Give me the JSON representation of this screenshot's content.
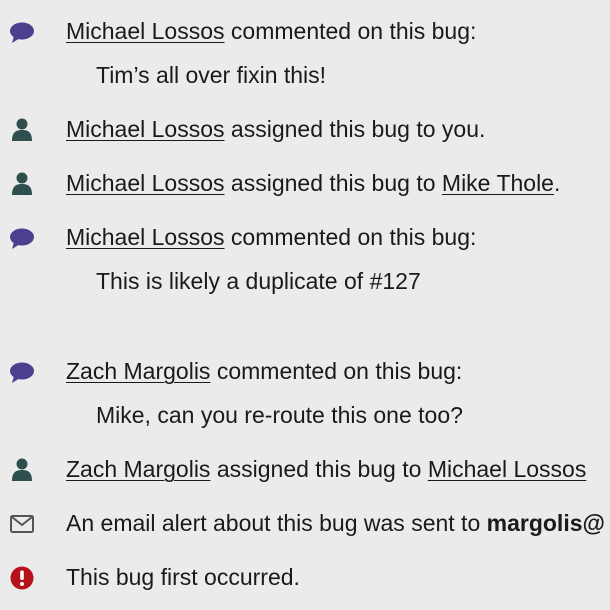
{
  "colors": {
    "comment_icon": "#4b3f8f",
    "person_icon": "#2f4f4f",
    "mail_icon": "#555555",
    "alert_icon": "#b5121b",
    "background": "#ebebeb"
  },
  "activity": [
    {
      "icon": "speech-bubble-icon",
      "actor": "Michael Lossos",
      "action": "commented on this bug:",
      "comment": "Tim’s all over fixin this!"
    },
    {
      "icon": "person-icon",
      "actor": "Michael Lossos",
      "action": "assigned this bug to you."
    },
    {
      "icon": "person-icon",
      "actor": "Michael Lossos",
      "action": "assigned this bug to",
      "target": "Mike Thole",
      "suffix": "."
    },
    {
      "icon": "speech-bubble-icon",
      "actor": "Michael Lossos",
      "action": "commented on this bug:",
      "comment": "This is likely a duplicate of #127"
    },
    {
      "icon": "speech-bubble-icon",
      "actor": "Zach Margolis",
      "action": "commented on this bug:",
      "comment": "Mike, can you re-route this one too?"
    },
    {
      "icon": "person-icon",
      "actor": "Zach Margolis",
      "action": "assigned this bug to",
      "target": "Michael Lossos"
    },
    {
      "icon": "envelope-icon",
      "text": "An email alert about this bug was sent to",
      "email": "margolis@"
    },
    {
      "icon": "exclamation-circle-icon",
      "text": "This bug first occurred."
    }
  ]
}
